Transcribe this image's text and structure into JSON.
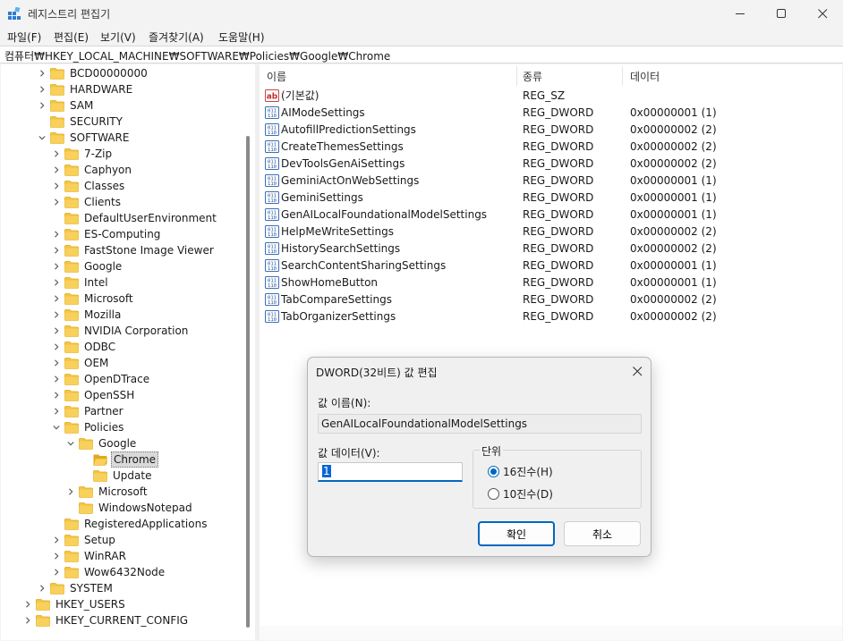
{
  "window": {
    "title": "레지스트리 편집기"
  },
  "menu": [
    "파일(F)",
    "편집(E)",
    "보기(V)",
    "즐겨찾기(A)",
    "도움말(H)"
  ],
  "address": "컴퓨터₩HKEY_LOCAL_MACHINE₩SOFTWARE₩Policies₩Google₩Chrome",
  "tree": [
    {
      "label": "BCD00000000",
      "expand": ">"
    },
    {
      "label": "HARDWARE",
      "expand": ">"
    },
    {
      "label": "SAM",
      "expand": ">"
    },
    {
      "label": "SECURITY",
      "expand": ""
    },
    {
      "label": "SOFTWARE",
      "expand": "v"
    },
    {
      "label": "7-Zip",
      "expand": ">"
    },
    {
      "label": "Caphyon",
      "expand": ">"
    },
    {
      "label": "Classes",
      "expand": ">"
    },
    {
      "label": "Clients",
      "expand": ">"
    },
    {
      "label": "DefaultUserEnvironment",
      "expand": ""
    },
    {
      "label": "ES-Computing",
      "expand": ">"
    },
    {
      "label": "FastStone Image Viewer",
      "expand": ">"
    },
    {
      "label": "Google",
      "expand": ">"
    },
    {
      "label": "Intel",
      "expand": ">"
    },
    {
      "label": "Microsoft",
      "expand": ">"
    },
    {
      "label": "Mozilla",
      "expand": ">"
    },
    {
      "label": "NVIDIA Corporation",
      "expand": ">"
    },
    {
      "label": "ODBC",
      "expand": ">"
    },
    {
      "label": "OEM",
      "expand": ">"
    },
    {
      "label": "OpenDTrace",
      "expand": ">"
    },
    {
      "label": "OpenSSH",
      "expand": ">"
    },
    {
      "label": "Partner",
      "expand": ">"
    },
    {
      "label": "Policies",
      "expand": "v"
    },
    {
      "label": "Google",
      "expand": "v"
    },
    {
      "label": "Chrome",
      "expand": "",
      "selected": true
    },
    {
      "label": "Update",
      "expand": ""
    },
    {
      "label": "Microsoft",
      "expand": ">"
    },
    {
      "label": "WindowsNotepad",
      "expand": ""
    },
    {
      "label": "RegisteredApplications",
      "expand": ""
    },
    {
      "label": "Setup",
      "expand": ">"
    },
    {
      "label": "WinRAR",
      "expand": ">"
    },
    {
      "label": "Wow6432Node",
      "expand": ">"
    },
    {
      "label": "SYSTEM",
      "expand": ">"
    },
    {
      "label": "HKEY_USERS",
      "expand": ">"
    },
    {
      "label": "HKEY_CURRENT_CONFIG",
      "expand": ">"
    }
  ],
  "columns": {
    "name": "이름",
    "type": "종류",
    "data": "데이터"
  },
  "values": [
    {
      "icon": "string-value-icon",
      "name": "(기본값)",
      "type": "REG_SZ",
      "data": ""
    },
    {
      "icon": "binary-value-icon",
      "name": "AIModeSettings",
      "type": "REG_DWORD",
      "data": "0x00000001 (1)"
    },
    {
      "icon": "binary-value-icon",
      "name": "AutofillPredictionSettings",
      "type": "REG_DWORD",
      "data": "0x00000002 (2)"
    },
    {
      "icon": "binary-value-icon",
      "name": "CreateThemesSettings",
      "type": "REG_DWORD",
      "data": "0x00000002 (2)"
    },
    {
      "icon": "binary-value-icon",
      "name": "DevToolsGenAiSettings",
      "type": "REG_DWORD",
      "data": "0x00000002 (2)"
    },
    {
      "icon": "binary-value-icon",
      "name": "GeminiActOnWebSettings",
      "type": "REG_DWORD",
      "data": "0x00000001 (1)"
    },
    {
      "icon": "binary-value-icon",
      "name": "GeminiSettings",
      "type": "REG_DWORD",
      "data": "0x00000001 (1)"
    },
    {
      "icon": "binary-value-icon",
      "name": "GenAILocalFoundationalModelSettings",
      "type": "REG_DWORD",
      "data": "0x00000001 (1)"
    },
    {
      "icon": "binary-value-icon",
      "name": "HelpMeWriteSettings",
      "type": "REG_DWORD",
      "data": "0x00000002 (2)"
    },
    {
      "icon": "binary-value-icon",
      "name": "HistorySearchSettings",
      "type": "REG_DWORD",
      "data": "0x00000002 (2)"
    },
    {
      "icon": "binary-value-icon",
      "name": "SearchContentSharingSettings",
      "type": "REG_DWORD",
      "data": "0x00000001 (1)"
    },
    {
      "icon": "binary-value-icon",
      "name": "ShowHomeButton",
      "type": "REG_DWORD",
      "data": "0x00000001 (1)"
    },
    {
      "icon": "binary-value-icon",
      "name": "TabCompareSettings",
      "type": "REG_DWORD",
      "data": "0x00000002 (2)"
    },
    {
      "icon": "binary-value-icon",
      "name": "TabOrganizerSettings",
      "type": "REG_DWORD",
      "data": "0x00000002 (2)"
    }
  ],
  "dialog": {
    "title": "DWORD(32비트) 값 편집",
    "name_label": "값 이름(N):",
    "name_value": "GenAILocalFoundationalModelSettings",
    "data_label": "값 데이터(V):",
    "data_value": "1",
    "base_label": "단위",
    "hex_label": "16진수(H)",
    "dec_label": "10진수(D)",
    "hex_selected": true,
    "ok_label": "확인",
    "cancel_label": "취소"
  },
  "colors": {
    "accent": "#0067c0",
    "folder": "#f5c542",
    "folder_dark": "#e0a91c"
  }
}
